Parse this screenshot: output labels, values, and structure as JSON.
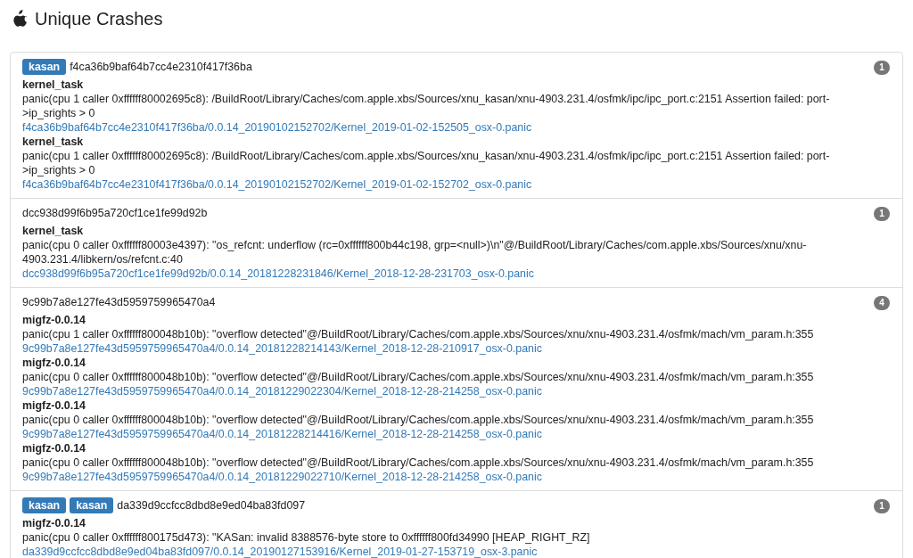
{
  "title": "Unique Crashes",
  "groups": [
    {
      "tags": [
        "kasan"
      ],
      "hash": "f4ca36b9baf64b7cc4e2310f417f36ba",
      "count": "1",
      "entries": [
        {
          "process": "kernel_task",
          "message": "panic(cpu 1 caller 0xffffff80002695c8): /BuildRoot/Library/Caches/com.apple.xbs/Sources/xnu_kasan/xnu-4903.231.4/osfmk/ipc/ipc_port.c:2151 Assertion failed: port->ip_srights > 0",
          "link": "f4ca36b9baf64b7cc4e2310f417f36ba/0.0.14_20190102152702/Kernel_2019-01-02-152505_osx-0.panic"
        },
        {
          "process": "kernel_task",
          "message": "panic(cpu 1 caller 0xffffff80002695c8): /BuildRoot/Library/Caches/com.apple.xbs/Sources/xnu_kasan/xnu-4903.231.4/osfmk/ipc/ipc_port.c:2151 Assertion failed: port->ip_srights > 0",
          "link": "f4ca36b9baf64b7cc4e2310f417f36ba/0.0.14_20190102152702/Kernel_2019-01-02-152702_osx-0.panic"
        }
      ]
    },
    {
      "hash": "dcc938d99f6b95a720cf1ce1fe99d92b",
      "count": "1",
      "entries": [
        {
          "process": "kernel_task",
          "message": "panic(cpu 0 caller 0xffffff80003e4397): \"os_refcnt: underflow (rc=0xffffff800b44c198, grp=<null>)\\n\"@/BuildRoot/Library/Caches/com.apple.xbs/Sources/xnu/xnu-4903.231.4/libkern/os/refcnt.c:40",
          "link": "dcc938d99f6b95a720cf1ce1fe99d92b/0.0.14_20181228231846/Kernel_2018-12-28-231703_osx-0.panic"
        }
      ]
    },
    {
      "hash": "9c99b7a8e127fe43d5959759965470a4",
      "count": "4",
      "entries": [
        {
          "process": "migfz-0.0.14",
          "message": "panic(cpu 1 caller 0xffffff800048b10b): \"overflow detected\"@/BuildRoot/Library/Caches/com.apple.xbs/Sources/xnu/xnu-4903.231.4/osfmk/mach/vm_param.h:355",
          "link": "9c99b7a8e127fe43d5959759965470a4/0.0.14_20181228214143/Kernel_2018-12-28-210917_osx-0.panic"
        },
        {
          "process": "migfz-0.0.14",
          "message": "panic(cpu 0 caller 0xffffff800048b10b): \"overflow detected\"@/BuildRoot/Library/Caches/com.apple.xbs/Sources/xnu/xnu-4903.231.4/osfmk/mach/vm_param.h:355",
          "link": "9c99b7a8e127fe43d5959759965470a4/0.0.14_20181229022304/Kernel_2018-12-28-214258_osx-0.panic"
        },
        {
          "process": "migfz-0.0.14",
          "message": "panic(cpu 0 caller 0xffffff800048b10b): \"overflow detected\"@/BuildRoot/Library/Caches/com.apple.xbs/Sources/xnu/xnu-4903.231.4/osfmk/mach/vm_param.h:355",
          "link": "9c99b7a8e127fe43d5959759965470a4/0.0.14_20181228214416/Kernel_2018-12-28-214258_osx-0.panic"
        },
        {
          "process": "migfz-0.0.14",
          "message": "panic(cpu 0 caller 0xffffff800048b10b): \"overflow detected\"@/BuildRoot/Library/Caches/com.apple.xbs/Sources/xnu/xnu-4903.231.4/osfmk/mach/vm_param.h:355",
          "link": "9c99b7a8e127fe43d5959759965470a4/0.0.14_20181229022710/Kernel_2018-12-28-214258_osx-0.panic"
        }
      ]
    },
    {
      "tags": [
        "kasan",
        "kasan"
      ],
      "hash": "da339d9ccfcc8dbd8e9ed04ba83fd097",
      "count": "1",
      "entries": [
        {
          "process": "migfz-0.0.14",
          "message": "panic(cpu 0 caller 0xffffff800175d473): \"KASan: invalid 8388576-byte store to 0xffffff800fd34990 [HEAP_RIGHT_RZ]",
          "link": "da339d9ccfcc8dbd8e9ed04ba83fd097/0.0.14_20190127153916/Kernel_2019-01-27-153719_osx-3.panic"
        }
      ]
    }
  ]
}
